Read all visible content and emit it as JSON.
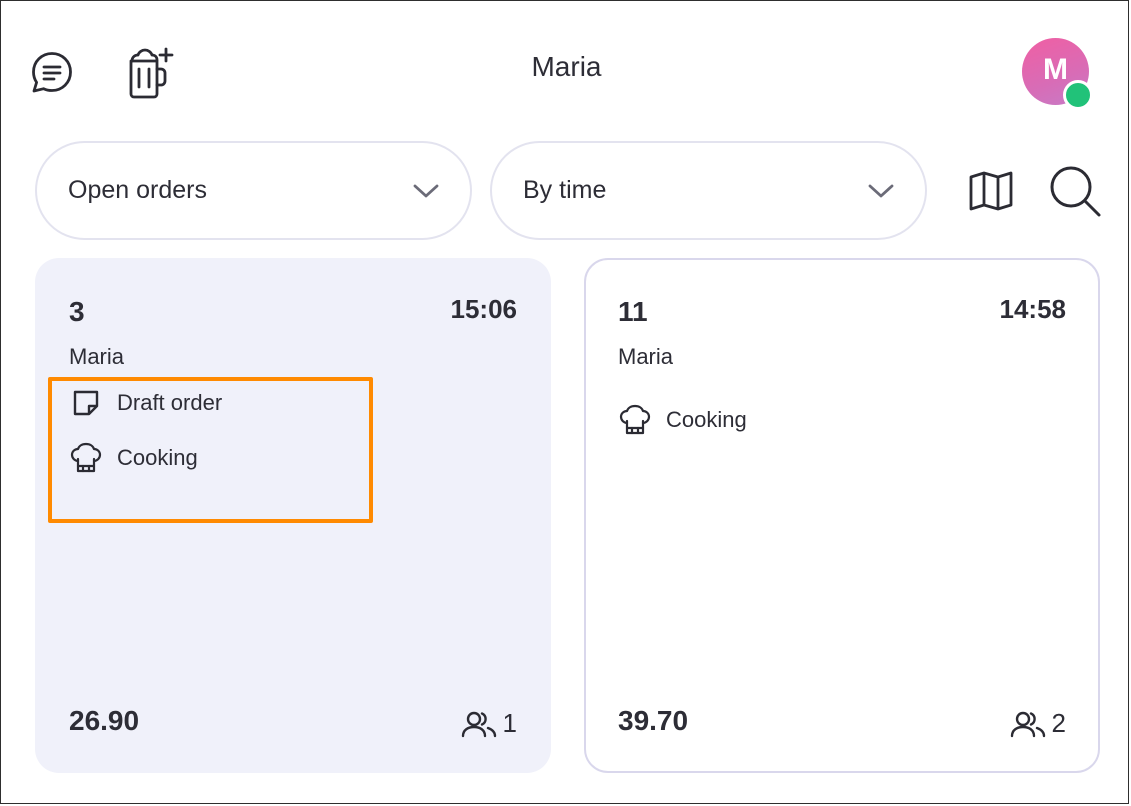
{
  "header": {
    "title": "Maria",
    "avatar_initial": "M",
    "icons": [
      "chat-icon",
      "add-drink-icon",
      "map-icon",
      "search-icon"
    ]
  },
  "filters": {
    "status_filter": "Open orders",
    "sort": "By time"
  },
  "orders": [
    {
      "table": "3",
      "time": "15:06",
      "waiter": "Maria",
      "statuses": [
        "Draft order",
        "Cooking"
      ],
      "total": "26.90",
      "guests": "1"
    },
    {
      "table": "11",
      "time": "14:58",
      "waiter": "Maria",
      "statuses": [
        "Cooking"
      ],
      "total": "39.70",
      "guests": "2"
    }
  ],
  "colors": {
    "highlight": "#ff8a00",
    "presence": "#21c279",
    "avatar": "#e866ad",
    "selected_card_bg": "#f0f1fa"
  }
}
